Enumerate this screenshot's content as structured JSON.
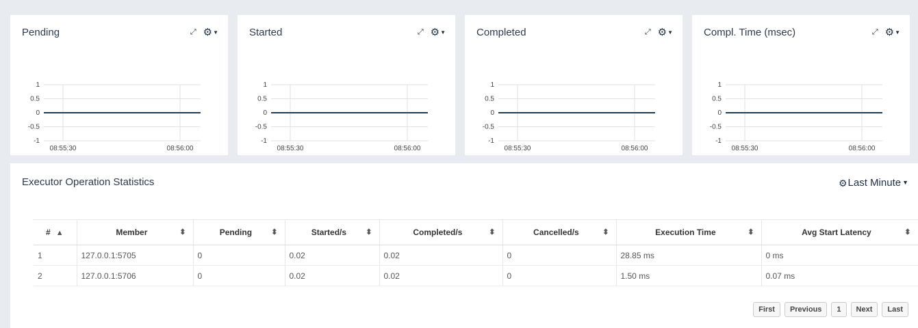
{
  "charts": [
    {
      "title": "Pending",
      "y_ticks": [
        "1",
        "0.5",
        "0",
        "-0.5",
        "-1"
      ],
      "x_ticks": [
        "08:55:30",
        "08:56:00"
      ]
    },
    {
      "title": "Started",
      "y_ticks": [
        "1",
        "0.5",
        "0",
        "-0.5",
        "-1"
      ],
      "x_ticks": [
        "08:55:30",
        "08:56:00"
      ]
    },
    {
      "title": "Completed",
      "y_ticks": [
        "1",
        "0.5",
        "0",
        "-0.5",
        "-1"
      ],
      "x_ticks": [
        "08:55:30",
        "08:56:00"
      ]
    },
    {
      "title": "Compl. Time (msec)",
      "y_ticks": [
        "1",
        "0.5",
        "0",
        "-0.5",
        "-1"
      ],
      "x_ticks": [
        "08:55:30",
        "08:56:00"
      ]
    }
  ],
  "icons": {
    "expand": "expand-icon",
    "gear": "gear-icon",
    "caret": "caret-down-icon",
    "sort": "sort-icon"
  },
  "colors": {
    "series_line": "#1e3a52",
    "grid": "#e2e2e2",
    "title": "#2b3b4e"
  },
  "stats": {
    "title": "Executor Operation Statistics",
    "range_label": "Last Minute",
    "columns": [
      "#",
      "Member",
      "Pending",
      "Started/s",
      "Completed/s",
      "Cancelled/s",
      "Execution Time",
      "Avg Start Latency"
    ],
    "rows": [
      [
        "1",
        "127.0.0.1:5705",
        "0",
        "0.02",
        "0.02",
        "0",
        "28.85 ms",
        "0 ms"
      ],
      [
        "2",
        "127.0.0.1:5706",
        "0",
        "0.02",
        "0.02",
        "0",
        "1.50 ms",
        "0.07 ms"
      ]
    ]
  },
  "pager": {
    "first": "First",
    "previous": "Previous",
    "page": "1",
    "next": "Next",
    "last": "Last"
  }
}
